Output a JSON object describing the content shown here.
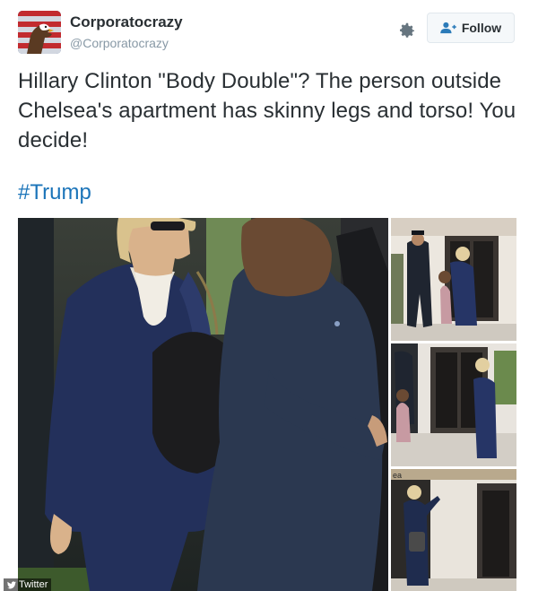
{
  "user": {
    "name": "Corporatocrazy",
    "handle": "@Corporatocrazy",
    "avatar_icon": "eagle-flag-avatar"
  },
  "actions": {
    "settings_icon": "gear-icon",
    "follow_label": "Follow",
    "follow_icon": "add-user-icon"
  },
  "tweet": {
    "text": "Hillary Clinton \"Body Double\"? The person outside Chelsea's apartment has skinny legs and torso! You decide!",
    "hashtag": "#Trump"
  },
  "media": {
    "thumb3_sign": "ea"
  },
  "watermark": {
    "label": "Twitter",
    "icon": "bird-icon"
  },
  "colors": {
    "link": "#1b74b9",
    "text": "#292f33",
    "muted": "#8899a6",
    "button_bg": "#f5f8fa",
    "button_border": "#e1e8ed"
  }
}
